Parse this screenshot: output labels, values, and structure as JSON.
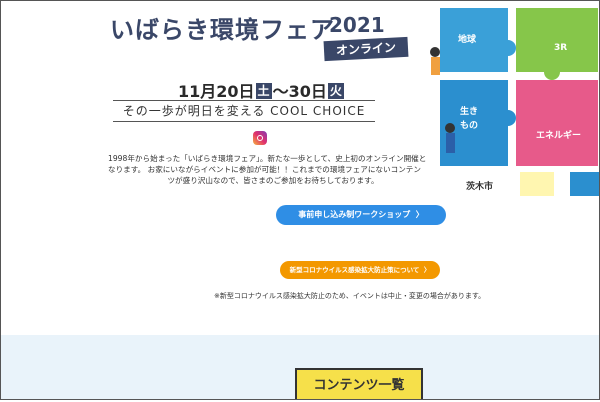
{
  "header": {
    "title": "いばらき環境フェア",
    "year": "2021",
    "online_badge": "オンライン"
  },
  "dates": {
    "start": "11月20日",
    "start_day": "土",
    "sep": "〜",
    "end": "30日",
    "end_day": "火"
  },
  "tagline": "その一歩が明日を変える COOL CHOICE",
  "intro": {
    "line1": "1998年から始まった「いばらき環境フェア」。新たな一歩として、史上初のオンライン開催と",
    "line2": "なります。 お家にいながらイベントに参加が可能！！これまでの環境フェアにないコンテン",
    "line3": "ツが盛り沢山なので、皆さまのご参加をお待ちしております。"
  },
  "buttons": {
    "workshop": "事前申し込み制ワークショップ",
    "covid": "新型コロナウイルス感染拡大防止策について"
  },
  "notice": "※新型コロナウイルス感染拡大防止のため、イベントは中止・変更の場合があります。",
  "contents_title": "コンテンツ一覧",
  "puzzle": {
    "chikyu": "地球",
    "three_r": "3R",
    "ikimono_1": "生き",
    "ikimono_2": "もの",
    "energy": "エネルギー",
    "ibaraki_city": "茨木市"
  },
  "colors": {
    "navy": "#3a4768",
    "blue": "#2f8ee5",
    "orange": "#f39800",
    "yellow": "#f6e04a"
  }
}
